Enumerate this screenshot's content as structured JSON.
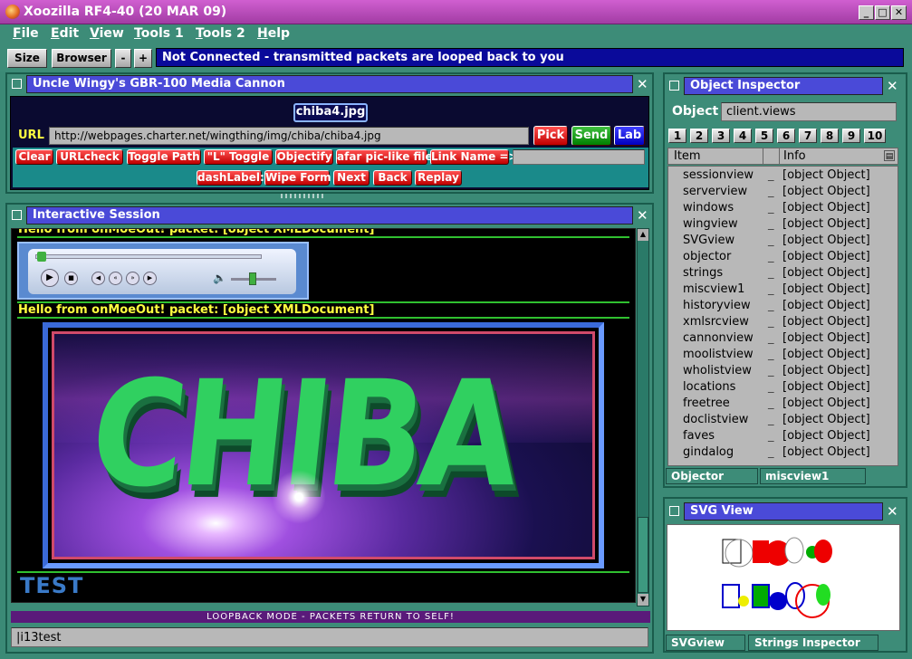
{
  "window": {
    "title": "Xoozilla RF4-40 (20 MAR 09)"
  },
  "menu": [
    {
      "u": "F",
      "rest": "ile"
    },
    {
      "u": "E",
      "rest": "dit"
    },
    {
      "u": "V",
      "rest": "iew"
    },
    {
      "u": "T",
      "rest": "ools 1"
    },
    {
      "u": "T",
      "rest": "ools 2"
    },
    {
      "u": "H",
      "rest": "elp"
    }
  ],
  "toolbar": {
    "size": "Size",
    "browser": "Browser",
    "minus": "-",
    "plus": "+",
    "status": "Not Connected - transmitted packets are looped back to you"
  },
  "cannon": {
    "title": "Uncle Wingy's GBR-100 Media Cannon",
    "filename": "chiba4.jpg",
    "url_label": "URL",
    "url": "http://webpages.charter.net/wingthing/img/chiba/chiba4.jpg",
    "pick": "Pick",
    "send": "Send",
    "lab": "Lab",
    "row1": [
      "Clear",
      "URLcheck",
      "Toggle Path",
      "\"L\" Toggle",
      "Objectify",
      "afar pic-like file!",
      "Link Name =>"
    ],
    "row2": [
      "dashLabel:",
      "Wipe Form",
      "Next",
      "Back",
      "Replay"
    ]
  },
  "session": {
    "title": "Interactive Session",
    "line_top": "Hello from onMoeOut! packet: [object XMLDocument]",
    "line_mid": "Hello from onMoeOut! packet: [object XMLDocument]",
    "image_text": "CHIBA",
    "test": "TEST",
    "loopback": "LOOPBACK MODE - PACKETS RETURN TO SELF!",
    "input": "|i13test"
  },
  "inspector": {
    "title": "Object Inspector",
    "object_label": "Object",
    "object_value": "client.views",
    "tabs": [
      "1",
      "2",
      "3",
      "4",
      "5",
      "6",
      "7",
      "8",
      "9",
      "10"
    ],
    "col_item": "Item",
    "col_info": "Info",
    "items": [
      "sessionview",
      "serverview",
      "windows",
      "wingview",
      "SVGview",
      "objector",
      "strings",
      "miscview1",
      "historyview",
      "xmlsrcview",
      "cannonview",
      "moolistview",
      "wholistview",
      "locations",
      "freetree",
      "doclistview",
      "faves",
      "gindalog"
    ],
    "info": "[object Object]",
    "bottom_tabs": [
      "Objector",
      "miscview1"
    ]
  },
  "svgview": {
    "title": "SVG View",
    "bottom_tabs": [
      "SVGview",
      "Strings Inspector"
    ]
  },
  "colors": {
    "title": "#b44cb4",
    "panel": "#3d8c78",
    "status": "#0a0a9a",
    "red_button": "#e00000"
  }
}
